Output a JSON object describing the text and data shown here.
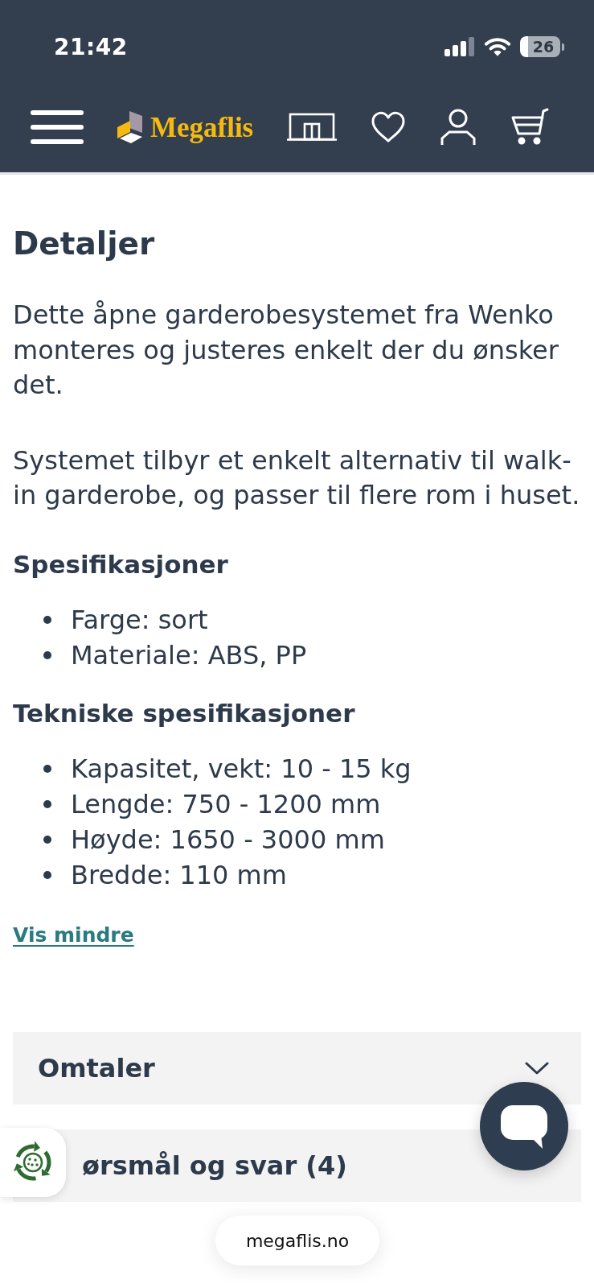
{
  "status_bar": {
    "time": "21:42",
    "battery": "26"
  },
  "header": {
    "logo": "Megaflis"
  },
  "details": {
    "title": "Detaljer",
    "paragraphs": [
      "Dette åpne garderobesystemet fra Wenko monteres og justeres enkelt der du ønsker det.",
      "Systemet tilbyr et enkelt alternativ til walk-in garderobe, og passer til flere rom i huset."
    ],
    "sections": [
      {
        "title": "Spesifikasjoner",
        "items": [
          "Farge: sort",
          "Materiale: ABS, PP"
        ]
      },
      {
        "title": "Tekniske spesifikasjoner",
        "items": [
          "Kapasitet, vekt: 10 - 15 kg",
          "Lengde: 750 - 1200 mm",
          "Høyde: 1650 - 3000 mm",
          "Bredde: 110 mm"
        ]
      }
    ],
    "toggle_link": "Vis mindre"
  },
  "accordions": [
    {
      "title": "Omtaler",
      "expanded": false
    },
    {
      "title": "ørsmål og svar (4)"
    }
  ],
  "browser": {
    "address": "megaflis.no"
  }
}
